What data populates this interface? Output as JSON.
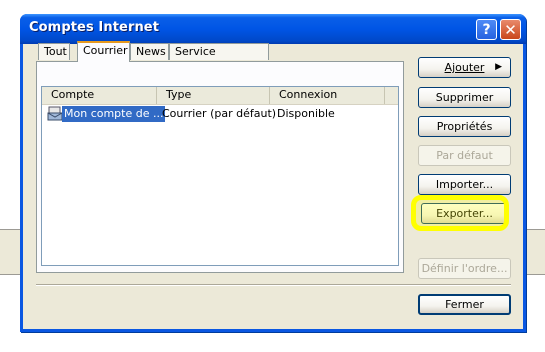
{
  "window": {
    "title": "Comptes Internet",
    "help_glyph": "?",
    "close_glyph": "✕"
  },
  "tabs": [
    {
      "label": "Tout",
      "active": false
    },
    {
      "label": "Courrier",
      "active": true
    },
    {
      "label": "News",
      "active": false
    },
    {
      "label": "Service d'annuaire",
      "active": false
    }
  ],
  "list": {
    "columns": [
      "Compte",
      "Type",
      "Connexion"
    ],
    "rows": [
      {
        "compte": "Mon compte de ...",
        "type": "Courrier (par défaut)",
        "connexion": "Disponible",
        "selected": true,
        "icon": "mail-account-icon"
      }
    ]
  },
  "buttons": {
    "ajouter": "Ajouter",
    "supprimer": "Supprimer",
    "proprietes": "Propriétés",
    "par_defaut": "Par défaut",
    "importer": "Importer...",
    "exporter": "Exporter...",
    "definir_ordre": "Définir l'ordre...",
    "fermer": "Fermer"
  },
  "colors": {
    "titlebar": "#0055e5",
    "selection": "#316ac5",
    "highlight": "#ffff00"
  }
}
